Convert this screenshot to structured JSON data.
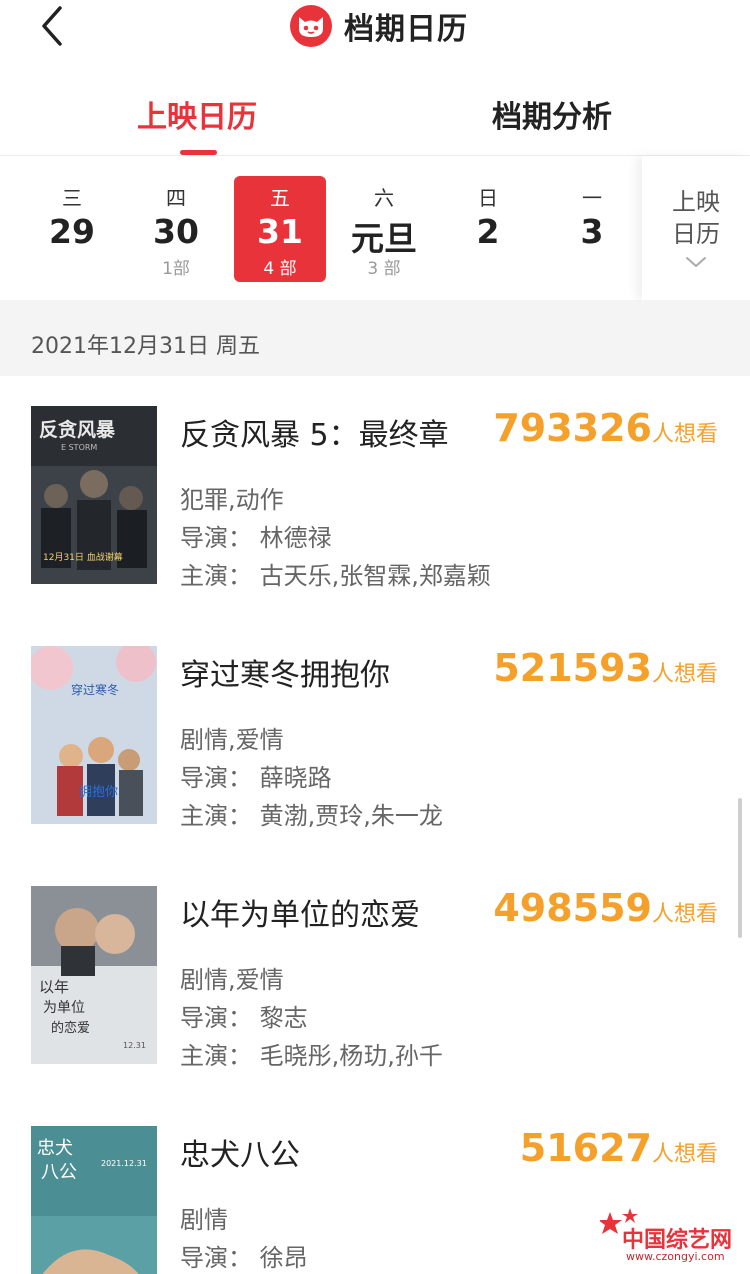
{
  "header": {
    "title": "档期日历",
    "back_icon": "back-arrow-icon",
    "logo_icon": "cat-logo-icon"
  },
  "tabs": [
    {
      "label": "上映日历",
      "active": true
    },
    {
      "label": "档期分析",
      "active": false
    }
  ],
  "dates": [
    {
      "weekday": "三",
      "day": "29",
      "count": ""
    },
    {
      "weekday": "四",
      "day": "30",
      "count": "1部"
    },
    {
      "weekday": "五",
      "day": "31",
      "count": "4 部",
      "selected": true
    },
    {
      "weekday": "六",
      "day": "元旦",
      "count": "3 部"
    },
    {
      "weekday": "日",
      "day": "2",
      "count": ""
    },
    {
      "weekday": "一",
      "day": "3",
      "count": ""
    }
  ],
  "calendar_button": {
    "label": "上映日历",
    "icon": "chevron-down-icon"
  },
  "date_header": "2021年12月31日 周五",
  "movies": [
    {
      "title": "反贪风暴 5：最终章",
      "want_count": "793326",
      "want_suffix": "人想看",
      "genre": "犯罪,动作",
      "director": "导演：  林德禄",
      "cast": "主演：  古天乐,张智霖,郑嘉颖",
      "poster_lines": [
        "反贪风暴",
        "E STORM",
        "12月31日  血战谢幕"
      ]
    },
    {
      "title": "穿过寒冬拥抱你",
      "want_count": "521593",
      "want_suffix": "人想看",
      "genre": "剧情,爱情",
      "director": "导演：  薛晓路",
      "cast": "主演：  黄渤,贾玲,朱一龙",
      "poster_lines": [
        "穿过寒冬",
        "拥抱你"
      ]
    },
    {
      "title": "以年为单位的恋爱",
      "want_count": "498559",
      "want_suffix": "人想看",
      "genre": "剧情,爱情",
      "director": "导演：  黎志",
      "cast": "主演：  毛晓彤,杨玏,孙千",
      "poster_lines": [
        "以年",
        "为单位",
        "的恋爱",
        "12.31"
      ]
    },
    {
      "title": "忠犬八公",
      "want_count": "51627",
      "want_suffix": "人想看",
      "genre": "剧情",
      "director": "导演：  徐昂",
      "cast": "",
      "poster_lines": [
        "忠犬",
        "八公",
        "2021.12.31"
      ]
    }
  ],
  "watermark": {
    "text": "中国综艺网",
    "url": "www.czongyi.com"
  },
  "colors": {
    "accent": "#e8333b",
    "want": "#f4a02a"
  }
}
